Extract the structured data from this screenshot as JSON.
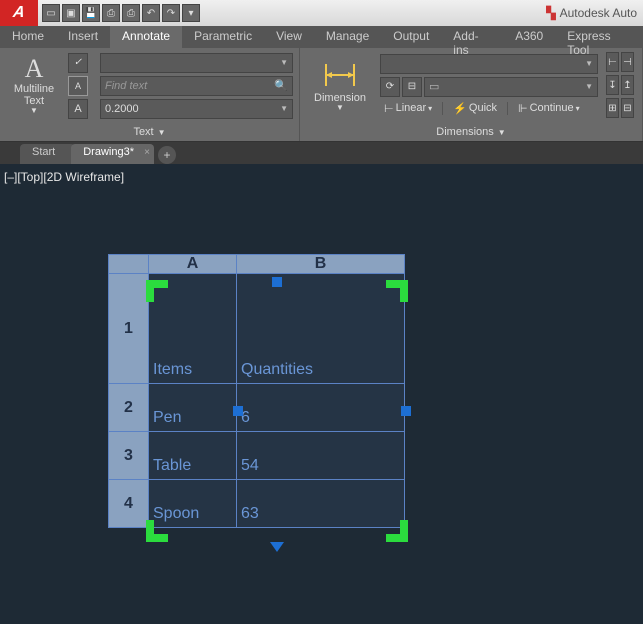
{
  "app": {
    "title": "Autodesk Auto"
  },
  "ribbon": {
    "tabs": [
      "Home",
      "Insert",
      "Annotate",
      "Parametric",
      "View",
      "Manage",
      "Output",
      "Add-ins",
      "A360",
      "Express Tool"
    ],
    "active": "Annotate",
    "text_panel": {
      "title": "Text",
      "button": "Multiline\nText",
      "find_placeholder": "Find text",
      "height_value": "0.2000"
    },
    "dim_panel": {
      "title": "Dimensions",
      "button": "Dimension",
      "linear": "Linear",
      "quick": "Quick",
      "continue": "Continue"
    }
  },
  "docs": {
    "tabs": [
      "Start",
      "Drawing3*"
    ],
    "active": 1
  },
  "viewport": {
    "label": "[–][Top][2D Wireframe]"
  },
  "table": {
    "cols": [
      "A",
      "B"
    ],
    "rows": [
      "1",
      "2",
      "3",
      "4"
    ],
    "cells": {
      "A1": "Items",
      "B1": "Quantities",
      "A2": "Pen",
      "B2": "6",
      "A3": "Table",
      "B3": "54",
      "A4": "Spoon",
      "B4": "63"
    }
  }
}
